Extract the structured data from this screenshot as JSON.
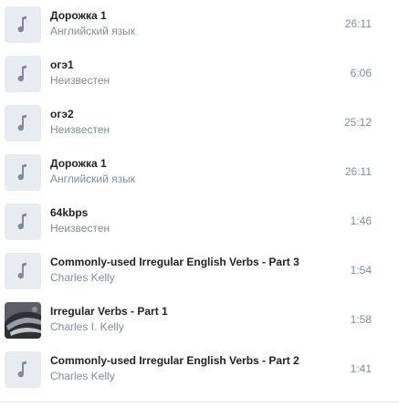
{
  "tracks": [
    {
      "title": "Дорожка 1",
      "artist": "Английский язык",
      "duration": "26:11",
      "cover": "music-note-icon"
    },
    {
      "title": "огэ1",
      "artist": "Неизвестен",
      "duration": "6:06",
      "cover": "music-note-icon"
    },
    {
      "title": "огэ2",
      "artist": "Неизвестен",
      "duration": "25:12",
      "cover": "music-note-icon"
    },
    {
      "title": "Дорожка 1",
      "artist": "Английский язык",
      "duration": "26:11",
      "cover": "music-note-icon"
    },
    {
      "title": "64kbps",
      "artist": "Неизвестен",
      "duration": "1:46",
      "cover": "music-note-icon"
    },
    {
      "title": "Commonly-used Irregular English Verbs - Part 3",
      "artist": "Charles Kelly",
      "duration": "1:54",
      "cover": "music-note-icon"
    },
    {
      "title": "Irregular Verbs - Part 1",
      "artist": "Charles I. Kelly",
      "duration": "1:58",
      "cover": "album-art"
    },
    {
      "title": "Commonly-used Irregular English Verbs - Part 2",
      "artist": "Charles Kelly",
      "duration": "1:41",
      "cover": "music-note-icon"
    }
  ],
  "colors": {
    "title": "#222222",
    "secondary": "#818c99",
    "cover_bg": "#e8ebf0",
    "note_icon": "#818c99"
  }
}
